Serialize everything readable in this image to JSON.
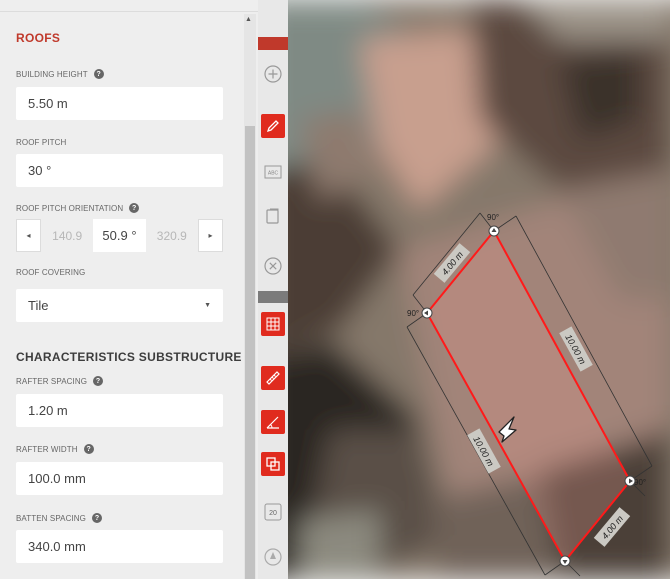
{
  "panel": {
    "section_title": "ROOFS",
    "building_height": {
      "label": "BUILDING HEIGHT",
      "value": "5.50 m"
    },
    "roof_pitch": {
      "label": "ROOF PITCH",
      "value": "30 °"
    },
    "roof_pitch_orientation": {
      "label": "ROOF PITCH ORIENTATION",
      "prev": "140.9",
      "current": "50.9 °",
      "next": "320.9"
    },
    "roof_covering": {
      "label": "ROOF COVERING",
      "value": "Tile"
    },
    "substructure_title": "CHARACTERISTICS SUBSTRUCTURE",
    "rafter_spacing": {
      "label": "RAFTER SPACING",
      "value": "1.20 m"
    },
    "rafter_width": {
      "label": "RAFTER WIDTH",
      "value": "100.0 mm"
    },
    "batten_spacing": {
      "label": "BATTEN SPACING",
      "value": "340.0 mm"
    }
  },
  "toolbar": {
    "abc_label": "ABC",
    "zoom_label": "20"
  },
  "map": {
    "dimensions": {
      "top": "4.00 m",
      "bottom": "4.00 m",
      "right": "10.00 m",
      "left": "10.00 m"
    },
    "angles": [
      "90°",
      "90°",
      "90°"
    ]
  },
  "colors": {
    "accent": "#c0392b",
    "outline": "#ff1a1a",
    "panel_bg": "#eeeeee"
  }
}
